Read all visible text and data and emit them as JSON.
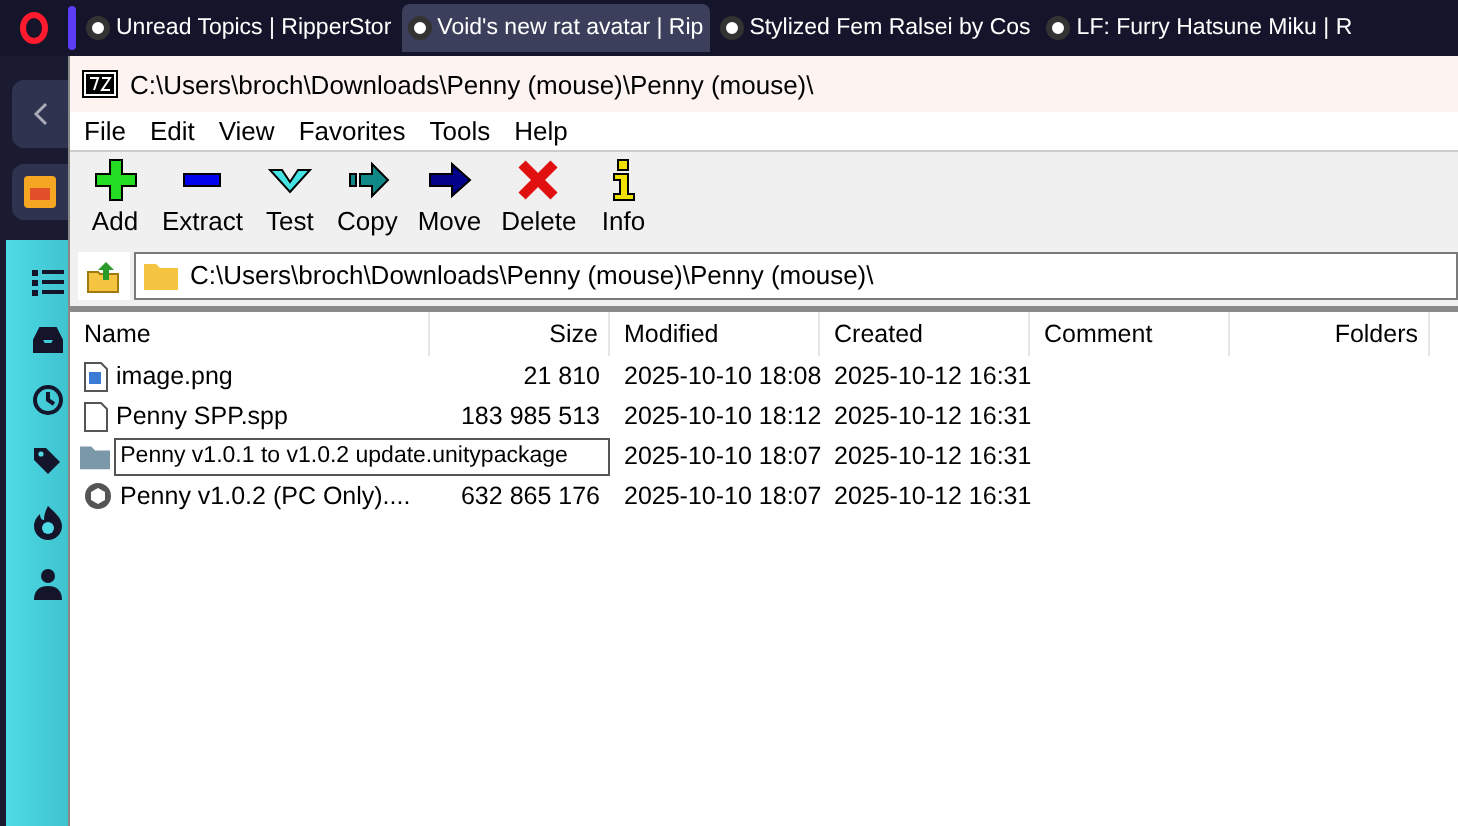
{
  "browser_tabs": [
    {
      "title": "Unread Topics | RipperStor",
      "selected": false
    },
    {
      "title": "Void's new rat avatar | Rip",
      "selected": true
    },
    {
      "title": "Stylized Fem Ralsei by Cos",
      "selected": false
    },
    {
      "title": "LF: Furry Hatsune Miku | R",
      "selected": false
    }
  ],
  "window": {
    "title": "C:\\Users\\broch\\Downloads\\Penny (mouse)\\Penny (mouse)\\"
  },
  "menu": [
    "File",
    "Edit",
    "View",
    "Favorites",
    "Tools",
    "Help"
  ],
  "toolbar": [
    {
      "kind": "add",
      "label": "Add"
    },
    {
      "kind": "extract",
      "label": "Extract"
    },
    {
      "kind": "test",
      "label": "Test"
    },
    {
      "kind": "copy",
      "label": "Copy"
    },
    {
      "kind": "move",
      "label": "Move"
    },
    {
      "kind": "delete",
      "label": "Delete"
    },
    {
      "kind": "info",
      "label": "Info"
    }
  ],
  "address": {
    "value": "C:\\Users\\broch\\Downloads\\Penny (mouse)\\Penny (mouse)\\"
  },
  "table": {
    "columns": [
      "Name",
      "Size",
      "Modified",
      "Created",
      "Comment",
      "Folders"
    ],
    "rows": [
      {
        "kind": "image",
        "name": "image.png",
        "size": "21 810",
        "modified": "2025-10-10 18:08",
        "created": "2025-10-12 16:31",
        "editing": false
      },
      {
        "kind": "file",
        "name": "Penny SPP.spp",
        "size": "183 985 513",
        "modified": "2025-10-10 18:12",
        "created": "2025-10-12 16:31",
        "editing": false
      },
      {
        "kind": "package",
        "name": "Penny v1.0.1 to v1.0.2 update.unitypackage",
        "modified": "2025-10-10 18:07",
        "created": "2025-10-12 16:31",
        "editing": true
      },
      {
        "kind": "unity",
        "name": "Penny v1.0.2 (PC Only)....",
        "size": "632 865 176",
        "modified": "2025-10-10 18:07",
        "created": "2025-10-12 16:31",
        "editing": false
      }
    ]
  }
}
